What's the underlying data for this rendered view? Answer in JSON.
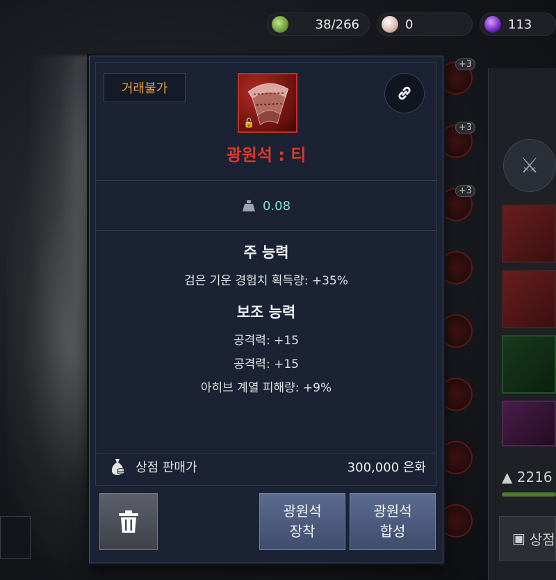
{
  "currency": [
    {
      "icon": "green-stone-icon",
      "value": "38/266"
    },
    {
      "icon": "pearl-icon",
      "value": "0"
    },
    {
      "icon": "purple-orb-icon",
      "value": "113"
    }
  ],
  "background": {
    "slot_badges": [
      "+3",
      "+3",
      "+3"
    ],
    "weight": "2216",
    "button_label": "상점"
  },
  "item": {
    "trade_badge": "거래불가",
    "icon": "ore-shard-icon",
    "name": "광원석 : 티",
    "name_color": "#e0352c",
    "weight": "0.08",
    "main_ability_title": "주 능력",
    "main_abilities": [
      "검은 기운 경험치 획득량: +35%"
    ],
    "sub_ability_title": "보조 능력",
    "sub_abilities": [
      "공격력: +15",
      "공격력: +15",
      "아히브 계열 피해량: +9%"
    ],
    "shop_price_label": "상점 판매가",
    "shop_price_value": "300,000 은화"
  },
  "buttons": {
    "delete_icon": "trash-icon",
    "equip": [
      "광원석",
      "장착"
    ],
    "combine": [
      "광원석",
      "합성"
    ]
  }
}
